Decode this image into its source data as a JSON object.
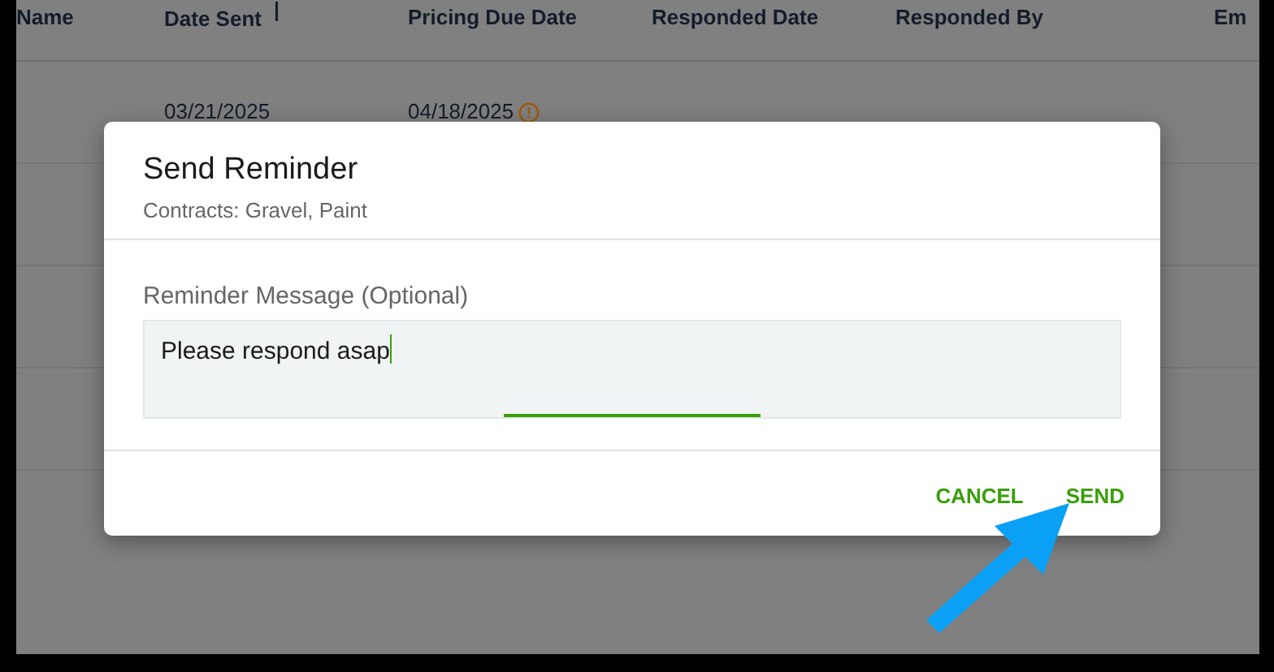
{
  "table": {
    "columns": [
      {
        "label": "Name",
        "sorted": false
      },
      {
        "label": "Date Sent",
        "sorted": true
      },
      {
        "label": "Pricing Due Date",
        "sorted": false
      },
      {
        "label": "Responded Date",
        "sorted": false
      },
      {
        "label": "Responded By",
        "sorted": false
      },
      {
        "label": "Em",
        "sorted": false
      }
    ],
    "rows": [
      {
        "cells": [
          "",
          "03/21/2025",
          "04/18/2025",
          "",
          "",
          ""
        ],
        "warning": true
      }
    ]
  },
  "dialog": {
    "title": "Send Reminder",
    "subtitle": "Contracts: Gravel, Paint",
    "field": {
      "label": "Reminder Message (Optional)",
      "value": "Please respond asap",
      "focused": true
    },
    "buttons": [
      {
        "label": "CANCEL"
      },
      {
        "label": "SEND"
      }
    ]
  }
}
